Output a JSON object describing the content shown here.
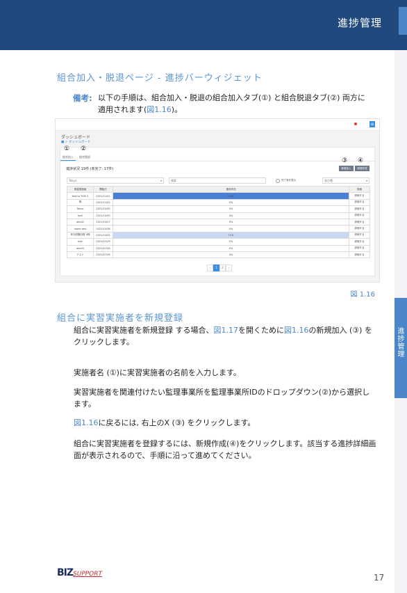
{
  "header": {
    "title": "進捗管理"
  },
  "side_tab": "進捗管理",
  "section1": {
    "title": "組合加入・脱退ページ - 進捗バーウィジェット",
    "note_label": "備考:",
    "note_line1": "以下の手順は、組合加入・脱退の組合加入タブ(①) と組合脱退タブ(②) 両方に",
    "note_line2a": "適用されます(",
    "note_line2_link": "図1.16",
    "note_line2b": ")。"
  },
  "figure": {
    "caption": "図 1.16",
    "crumb_title": "ダッシュボード",
    "crumb_path": "■ > ダッシュボード",
    "markers": [
      "①",
      "②",
      "③",
      "④"
    ],
    "tab1": "組合加入",
    "tab2": "組合脱退",
    "status": "進捗状況 19件 (未完了: 17件)",
    "btn_new": "新規加入",
    "btn_create": "新規作成",
    "filter_select": "Tokyo",
    "filter_search": "検索",
    "radio_label": "完了済を表示",
    "filter_sort": "並び替",
    "columns": [
      "実習実施者",
      "開始日",
      "進捗状況",
      "詳細"
    ],
    "rows": [
      {
        "name": "test to THIS 3",
        "date": "2021/11/01",
        "progress": "10%",
        "action": "詳細する"
      },
      {
        "name": "株",
        "date": "2021/11/02",
        "progress": "0%",
        "action": "詳細する"
      },
      {
        "name": "Tokyo",
        "date": "2021/10/30",
        "progress": "0%",
        "action": "詳細する"
      },
      {
        "name": "tom",
        "date": "2021/10/30",
        "progress": "0%",
        "action": "詳細する"
      },
      {
        "name": "abcd2",
        "date": "2021/10/27",
        "progress": "0%",
        "action": "詳細する"
      },
      {
        "name": "name test",
        "date": "2021/10/26",
        "progress": "0%",
        "action": "詳細する"
      },
      {
        "name": "年次試験日程 A株",
        "date": "2021/10/25",
        "progress": "11%",
        "action": "詳細する"
      },
      {
        "name": "test",
        "date": "2021/07/29",
        "progress": "0%",
        "action": "詳細する"
      },
      {
        "name": "abcd3",
        "date": "2021/07/28",
        "progress": "0%",
        "action": "詳細する"
      },
      {
        "name": "テスト",
        "date": "2021/07/28",
        "progress": "0%",
        "action": "詳細する"
      }
    ],
    "pager": [
      "‹",
      "1",
      "2",
      "›"
    ]
  },
  "section2": {
    "title": "組合に実習実施者を新規登録",
    "p1_a": "組合に実習実施者を新規登録 する場合、",
    "p1_link1": "図1.17",
    "p1_b": "を開くために",
    "p1_link2": "図1.16",
    "p1_c": "の新規加入 (③) を",
    "p1_line2": "クリックします。",
    "p2": "実施者名 (①)に実習実施者の名前を入力します。",
    "p3_line1": "実習実施者を関連付けたい監理事業所を監理事業所IDのドロップダウン(②)から選択し",
    "p3_line2": "ます。",
    "p4_link": "図1.16",
    "p4_rest": "に戻るには, 右上のX (③) をクリックします。",
    "p5_line1": "組合に実習実施者を登録するには、新規作成(④)をクリックします。該当する進捗詳細画",
    "p5_line2": "面が表示されるので、手順に沿って進めてください。"
  },
  "footer": {
    "logo_biz": "BIZ",
    "logo_support": "SUPPORT",
    "page_number": "17"
  },
  "colors": {
    "header": "#20497d",
    "accent": "#4a86c8",
    "link": "#4a86c8"
  }
}
